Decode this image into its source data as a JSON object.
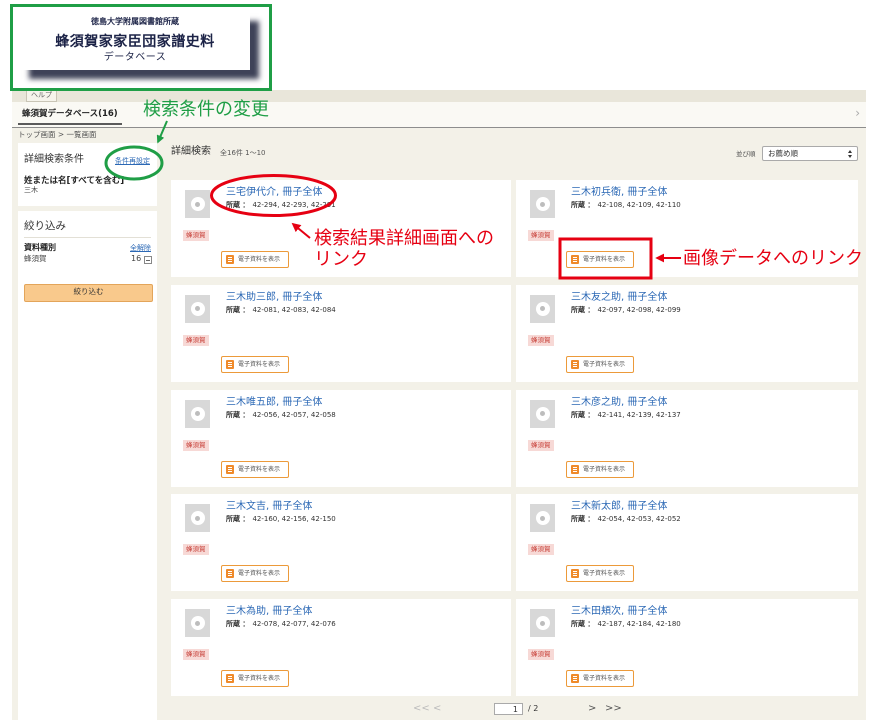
{
  "logo": {
    "line1": "徳島大学附属図書館所蔵",
    "line2": "蜂須賀家家臣団家譜史料",
    "line3": "データベース"
  },
  "nav": {
    "help_tab": "ヘルプ",
    "db_tab": "蜂須賀データベース(16)",
    "scroll_right": "›"
  },
  "breadcrumb": "トップ画面 > 一覧画面",
  "sidebar": {
    "conditions": {
      "title": "詳細検索条件",
      "reset_link": "条件再設定",
      "field_label": "姓または名[すべてを含む]",
      "field_value": "三木"
    },
    "filter": {
      "title": "絞り込み",
      "group_label": "資料種別",
      "clear_link": "全解除",
      "option_label": "蜂須賀",
      "option_count": "16",
      "apply_button": "絞り込む"
    }
  },
  "results": {
    "title": "詳細検索",
    "summary": "全16件 1〜10",
    "sort_label": "並び順",
    "sort_selected": "お薦め順",
    "holdings_label": "所蔵 ：",
    "badge_label": "蜂須賀",
    "view_button_label": "電子資料を表示",
    "items": [
      {
        "title": "三宅伊代介, 冊子全体",
        "holdings": "42-294, 42-293, 42-291"
      },
      {
        "title": "三木初兵衛, 冊子全体",
        "holdings": "42-108, 42-109, 42-110"
      },
      {
        "title": "三木助三郎, 冊子全体",
        "holdings": "42-081, 42-083, 42-084"
      },
      {
        "title": "三木友之助, 冊子全体",
        "holdings": "42-097, 42-098, 42-099"
      },
      {
        "title": "三木唯五郎, 冊子全体",
        "holdings": "42-056, 42-057, 42-058"
      },
      {
        "title": "三木彦之助, 冊子全体",
        "holdings": "42-141, 42-139, 42-137"
      },
      {
        "title": "三木文吉, 冊子全体",
        "holdings": "42-160, 42-156, 42-150"
      },
      {
        "title": "三木新太郎, 冊子全体",
        "holdings": "42-054, 42-053, 42-052"
      },
      {
        "title": "三木為助, 冊子全体",
        "holdings": "42-078, 42-077, 42-076"
      },
      {
        "title": "三木田頬次, 冊子全体",
        "holdings": "42-187, 42-184, 42-180"
      }
    ]
  },
  "pagination": {
    "first": "<<",
    "prev": "<",
    "current": "1",
    "total": "/ 2",
    "next": ">",
    "last": ">>"
  },
  "annotations": {
    "condition_change": "検索条件の変更",
    "detail_link_line1": "検索結果詳細画面への",
    "detail_link_line2": "リンク",
    "image_link": "画像データへのリンク"
  },
  "colors": {
    "link": "#2b68b5",
    "annotation_green": "#1f9e46",
    "annotation_red": "#e60012",
    "button_orange": "#ec9a3a",
    "background": "#f3f1e8"
  }
}
